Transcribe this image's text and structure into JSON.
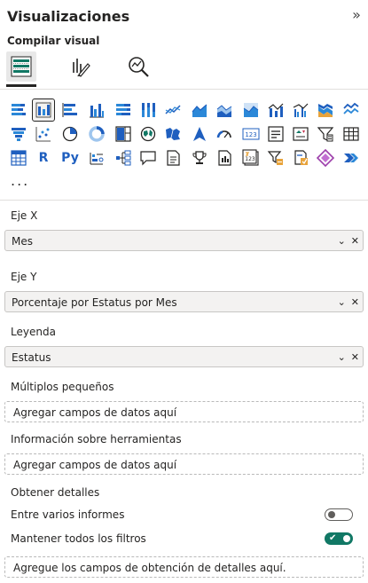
{
  "panel": {
    "title": "Visualizaciones",
    "collapse_icon": "»"
  },
  "build": {
    "section_label": "Compilar visual",
    "tabs": [
      {
        "name": "fields-tab",
        "active": true
      },
      {
        "name": "format-tab",
        "active": false
      },
      {
        "name": "analytics-tab",
        "active": false
      }
    ]
  },
  "gallery": {
    "more_label": "...",
    "rows": [
      [
        "stacked-bar-chart",
        "stacked-column-chart",
        "clustered-bar-chart",
        "clustered-column-chart",
        "100-stacked-bar-chart",
        "100-stacked-column-chart",
        "line-chart",
        "area-chart",
        "stacked-area-chart",
        "100-stacked-area-chart",
        "line-and-stacked-column-chart",
        "line-and-clustered-column-chart",
        "ribbon-chart"
      ],
      [
        "waterfall-chart",
        "funnel-chart",
        "scatter-chart",
        "pie-chart",
        "donut-chart",
        "treemap",
        "map",
        "filled-map",
        "azure-map",
        "gauge",
        "card",
        "multi-row-card",
        "kpi",
        "slicer",
        "table"
      ],
      [
        "matrix",
        "r-visual",
        "python-visual",
        "key-influencers",
        "decomposition-tree",
        "qa",
        "smart-narrative",
        "paginated-report",
        "metrics",
        "power-apps",
        "power-automate"
      ]
    ],
    "r_label": "R",
    "py_label": "Py",
    "card_label": "123"
  },
  "wells": {
    "x_axis": {
      "label": "Eje X",
      "value": "Mes"
    },
    "y_axis": {
      "label": "Eje Y",
      "value": "Porcentaje por Estatus por Mes"
    },
    "legend": {
      "label": "Leyenda",
      "value": "Estatus"
    },
    "small_multiples": {
      "label": "Múltiplos pequeños",
      "placeholder": "Agregar campos de datos aquí"
    },
    "tooltips": {
      "label": "Información sobre herramientas",
      "placeholder": "Agregar campos de datos aquí"
    }
  },
  "drillthrough": {
    "label": "Obtener detalles",
    "cross_report": {
      "label": "Entre varios informes",
      "on": false
    },
    "keep_filters": {
      "label": "Mantener todos los filtros",
      "on": true
    },
    "placeholder": "Agregue los campos de obtención de detalles aquí."
  },
  "colors": {
    "accent": "#117865",
    "blue_icon": "#1f5fbf",
    "light_blue_icon": "#2b88d8"
  }
}
